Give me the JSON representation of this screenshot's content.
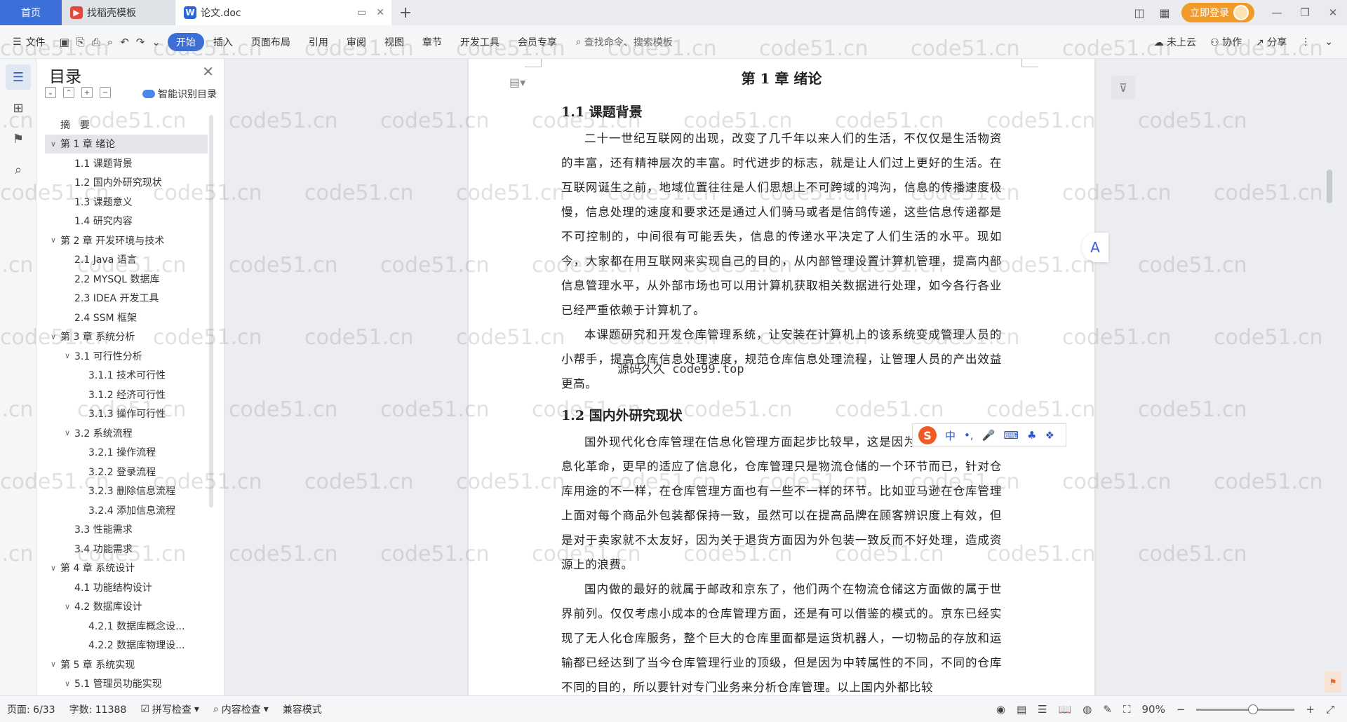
{
  "tabs": {
    "home": "首页",
    "templates": "找稻壳模板",
    "doc": "论文.doc"
  },
  "login": "立即登录",
  "menu": {
    "file": "文件",
    "tabs": [
      "开始",
      "插入",
      "页面布局",
      "引用",
      "审阅",
      "视图",
      "章节",
      "开发工具",
      "会员专享"
    ],
    "search": "查找命令、搜索模板",
    "cloud": "未上云",
    "collab": "协作",
    "share": "分享"
  },
  "toc": {
    "title": "目录",
    "smart": "智能识别目录",
    "items": [
      {
        "label": "摘　要",
        "level": 0,
        "chevron": ""
      },
      {
        "label": "第 1 章  绪论",
        "level": 0,
        "chevron": "v",
        "active": true
      },
      {
        "label": "1.1  课题背景",
        "level": 1,
        "chevron": ""
      },
      {
        "label": "1.2  国内外研究现状",
        "level": 1,
        "chevron": ""
      },
      {
        "label": "1.3  课题意义",
        "level": 1,
        "chevron": ""
      },
      {
        "label": "1.4  研究内容",
        "level": 1,
        "chevron": ""
      },
      {
        "label": "第 2 章  开发环境与技术",
        "level": 0,
        "chevron": "v"
      },
      {
        "label": "2.1 Java 语言",
        "level": 1,
        "chevron": ""
      },
      {
        "label": "2.2 MYSQL 数据库",
        "level": 1,
        "chevron": ""
      },
      {
        "label": "2.3 IDEA 开发工具",
        "level": 1,
        "chevron": ""
      },
      {
        "label": "2.4 SSM 框架",
        "level": 1,
        "chevron": ""
      },
      {
        "label": "第 3 章  系统分析",
        "level": 0,
        "chevron": "v"
      },
      {
        "label": "3.1  可行性分析",
        "level": 1,
        "chevron": "v"
      },
      {
        "label": "3.1.1  技术可行性",
        "level": 2,
        "chevron": ""
      },
      {
        "label": "3.1.2  经济可行性",
        "level": 2,
        "chevron": ""
      },
      {
        "label": "3.1.3  操作可行性",
        "level": 2,
        "chevron": ""
      },
      {
        "label": "3.2  系统流程",
        "level": 1,
        "chevron": "v"
      },
      {
        "label": "3.2.1  操作流程",
        "level": 2,
        "chevron": ""
      },
      {
        "label": "3.2.2  登录流程",
        "level": 2,
        "chevron": ""
      },
      {
        "label": "3.2.3  删除信息流程",
        "level": 2,
        "chevron": ""
      },
      {
        "label": "3.2.4  添加信息流程",
        "level": 2,
        "chevron": ""
      },
      {
        "label": "3.3  性能需求",
        "level": 1,
        "chevron": ""
      },
      {
        "label": "3.4  功能需求",
        "level": 1,
        "chevron": ""
      },
      {
        "label": "第 4 章  系统设计",
        "level": 0,
        "chevron": "v"
      },
      {
        "label": "4.1  功能结构设计",
        "level": 1,
        "chevron": ""
      },
      {
        "label": "4.2  数据库设计",
        "level": 1,
        "chevron": "v"
      },
      {
        "label": "4.2.1  数据库概念设...",
        "level": 2,
        "chevron": ""
      },
      {
        "label": "4.2.2  数据库物理设...",
        "level": 2,
        "chevron": ""
      },
      {
        "label": "第 5 章  系统实现",
        "level": 0,
        "chevron": "v"
      },
      {
        "label": "5.1  管理员功能实现",
        "level": 1,
        "chevron": "v"
      }
    ]
  },
  "doc": {
    "chapter": "第 1 章  绪论",
    "sec1": "1.1  课题背景",
    "p1": "二十一世纪互联网的出现，改变了几千年以来人们的生活，不仅仅是生活物资的丰富，还有精神层次的丰富。时代进步的标志，就是让人们过上更好的生活。在互联网诞生之前，地域位置往往是人们思想上不可跨域的鸿沟，信息的传播速度极慢，信息处理的速度和要求还是通过人们骑马或者是信鸽传递，这些信息传递都是不可控制的，中间很有可能丢失，信息的传递水平决定了人们生活的水平。现如今，大家都在用互联网来实现自己的目的，从内部管理设置计算机管理，提高内部信息管理水平，从外部市场也可以用计算机获取相关数据进行处理，如今各行各业已经严重依赖于计算机了。",
    "p2": "本课题研究和开发仓库管理系统，让安装在计算机上的该系统变成管理人员的小帮手，提高仓库信息处理速度，规范仓库信息处理流程，让管理人员的产出效益更高。",
    "sec2": "1.2  国内外研究现状",
    "p3": "国外现代化仓库管理在信息化管理方面起步比较早，这是因为国外先进行了信息化革命，更早的适应了信息化，仓库管理只是物流仓储的一个环节而已，针对仓库用途的不一样，在仓库管理方面也有一些不一样的环节。比如亚马逊在仓库管理上面对每个商品外包装都保持一致，虽然可以在提高品牌在顾客辨识度上有效，但是对于卖家就不太友好，因为关于退货方面因为外包装一致反而不好处理，造成资源上的浪费。",
    "p4": "国内做的最好的就属于邮政和京东了，他们两个在物流仓储这方面做的属于世界前列。仅仅考虑小成本的仓库管理方面，还是有可以借鉴的模式的。京东已经实现了无人化仓库服务，整个巨大的仓库里面都是运货机器人，一切物品的存放和运输都已经达到了当今仓库管理行业的顶级，但是因为中转属性的不同，不同的仓库不同的目的，所以要针对专门业务来分析仓库管理。以上国内外都比较"
  },
  "watermark": {
    "text": "code51.cn",
    "center": "源码久久 code99.top"
  },
  "ime": {
    "lang": "中",
    "punct": "•,"
  },
  "status": {
    "page": "页面: 6/33",
    "words": "字数: 11388",
    "spell": "拼写检查",
    "content_check": "内容检查",
    "compat": "兼容模式",
    "zoom": "90%"
  }
}
